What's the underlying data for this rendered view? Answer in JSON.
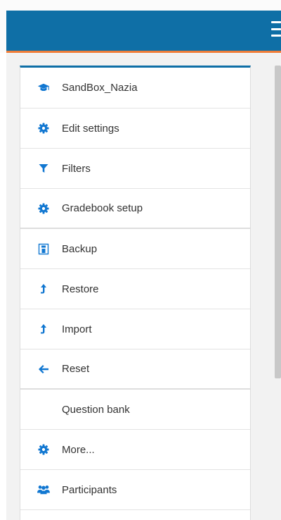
{
  "nav": {
    "items": [
      {
        "label": "SandBox_Nazia",
        "icon": "graduation-cap-icon"
      },
      {
        "label": "Edit settings",
        "icon": "gear-icon"
      },
      {
        "label": "Filters",
        "icon": "filter-icon"
      },
      {
        "label": "Gradebook setup",
        "icon": "gear-icon"
      },
      {
        "label": "Backup",
        "icon": "backup-file-icon"
      },
      {
        "label": "Restore",
        "icon": "upload-arrow-icon"
      },
      {
        "label": "Import",
        "icon": "upload-arrow-icon"
      },
      {
        "label": "Reset",
        "icon": "arrow-left-icon"
      },
      {
        "label": "Question bank",
        "icon": ""
      },
      {
        "label": "More...",
        "icon": "gear-icon"
      },
      {
        "label": "Participants",
        "icon": "users-icon"
      }
    ]
  },
  "colors": {
    "navbar": "#0f6fa6",
    "accent": "#f07d38",
    "icon": "#1177d1"
  }
}
